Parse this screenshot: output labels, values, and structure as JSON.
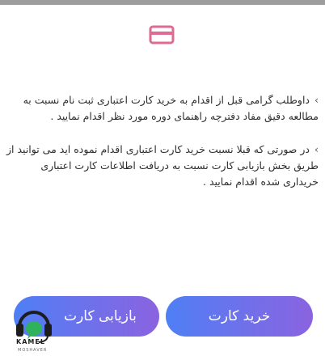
{
  "colors": {
    "icon": "#de6b93",
    "button_start": "#4f7ff5",
    "button_end": "#8b63e0",
    "text": "#2d2d2d"
  },
  "header": {
    "icon": "credit-card-icon"
  },
  "content": {
    "bullet": "›",
    "paragraphs": [
      "داوطلب گرامی قبل از اقدام به خرید کارت اعتباری ثبت نام نسبت به مطالعه دقیق مفاد دفترچه راهنمای دوره مورد نظر اقدام نمایید .",
      "در صورتی که قبلا نسبت خرید کارت اعتباری اقدام نموده اید می توانید از طریق بخش بازیابی کارت نسبت به دریافت اطلاعات کارت اعتباری خریداری شده اقدام نمایید ."
    ]
  },
  "buttons": {
    "buy_card": "خرید کارت",
    "recover_card": "بازیابی کارت"
  },
  "logo": {
    "word": "KAMEL",
    "sub": "MOSHAVER",
    "icon": "headset-chat-icon"
  }
}
